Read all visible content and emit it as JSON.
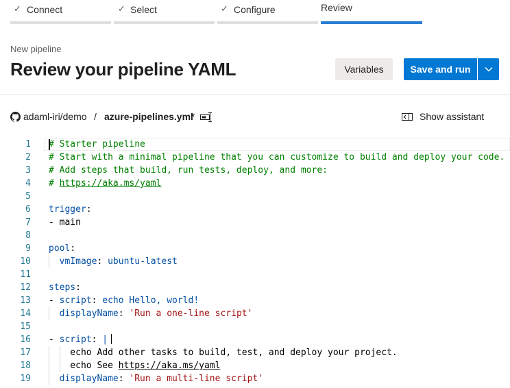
{
  "wizard": {
    "steps": [
      {
        "label": "Connect",
        "state": "done"
      },
      {
        "label": "Select",
        "state": "done"
      },
      {
        "label": "Configure",
        "state": "done"
      },
      {
        "label": "Review",
        "state": "active"
      }
    ]
  },
  "header": {
    "subtitle": "New pipeline",
    "title": "Review your pipeline YAML",
    "variables_label": "Variables",
    "save_run_label": "Save and run"
  },
  "path": {
    "repo": "adaml-iri/demo",
    "separator": "/",
    "file": "azure-pipelines.yml",
    "modified": "*",
    "show_assistant_label": "Show assistant"
  },
  "icons": {
    "github": "github-icon",
    "rename": "rename-icon",
    "assistant": "show-assistant-icon",
    "dropdown": "chevron-down-icon",
    "check": "checkmark-icon"
  },
  "colors": {
    "primary": "#0078d4",
    "active_step": "#2a7fd4",
    "comment": "#008000",
    "key": "#0451a5",
    "string": "#a31515",
    "line_number": "#237893"
  },
  "editor": {
    "lines": [
      {
        "num": "1",
        "text": "# Starter pipeline",
        "type": "comment"
      },
      {
        "num": "2",
        "text": "# Start with a minimal pipeline that you can customize to build and deploy your code.",
        "type": "comment"
      },
      {
        "num": "3",
        "text": "# Add steps that build, run tests, deploy, and more:",
        "type": "comment"
      },
      {
        "num": "4",
        "text": "# https://aka.ms/yaml",
        "type": "comment-link"
      },
      {
        "num": "5",
        "text": "",
        "type": "blank"
      },
      {
        "num": "6",
        "text": "trigger:",
        "type": "key"
      },
      {
        "num": "7",
        "text": "- main",
        "type": "plain"
      },
      {
        "num": "8",
        "text": "",
        "type": "blank"
      },
      {
        "num": "9",
        "text": "pool:",
        "type": "key"
      },
      {
        "num": "10",
        "text": "  vmImage: ubuntu-latest",
        "type": "kv"
      },
      {
        "num": "11",
        "text": "",
        "type": "blank"
      },
      {
        "num": "12",
        "text": "steps:",
        "type": "key"
      },
      {
        "num": "13",
        "text": "- script: echo Hello, world!",
        "type": "kv"
      },
      {
        "num": "14",
        "text": "  displayName: 'Run a one-line script'",
        "type": "kv-str"
      },
      {
        "num": "15",
        "text": "",
        "type": "blank"
      },
      {
        "num": "16",
        "text": "- script: |",
        "type": "kv"
      },
      {
        "num": "17",
        "text": "    echo Add other tasks to build, test, and deploy your project.",
        "type": "plain"
      },
      {
        "num": "18",
        "text": "    echo See https://aka.ms/yaml",
        "type": "plain-link"
      },
      {
        "num": "19",
        "text": "  displayName: 'Run a multi-line script'",
        "type": "kv-str"
      }
    ]
  }
}
